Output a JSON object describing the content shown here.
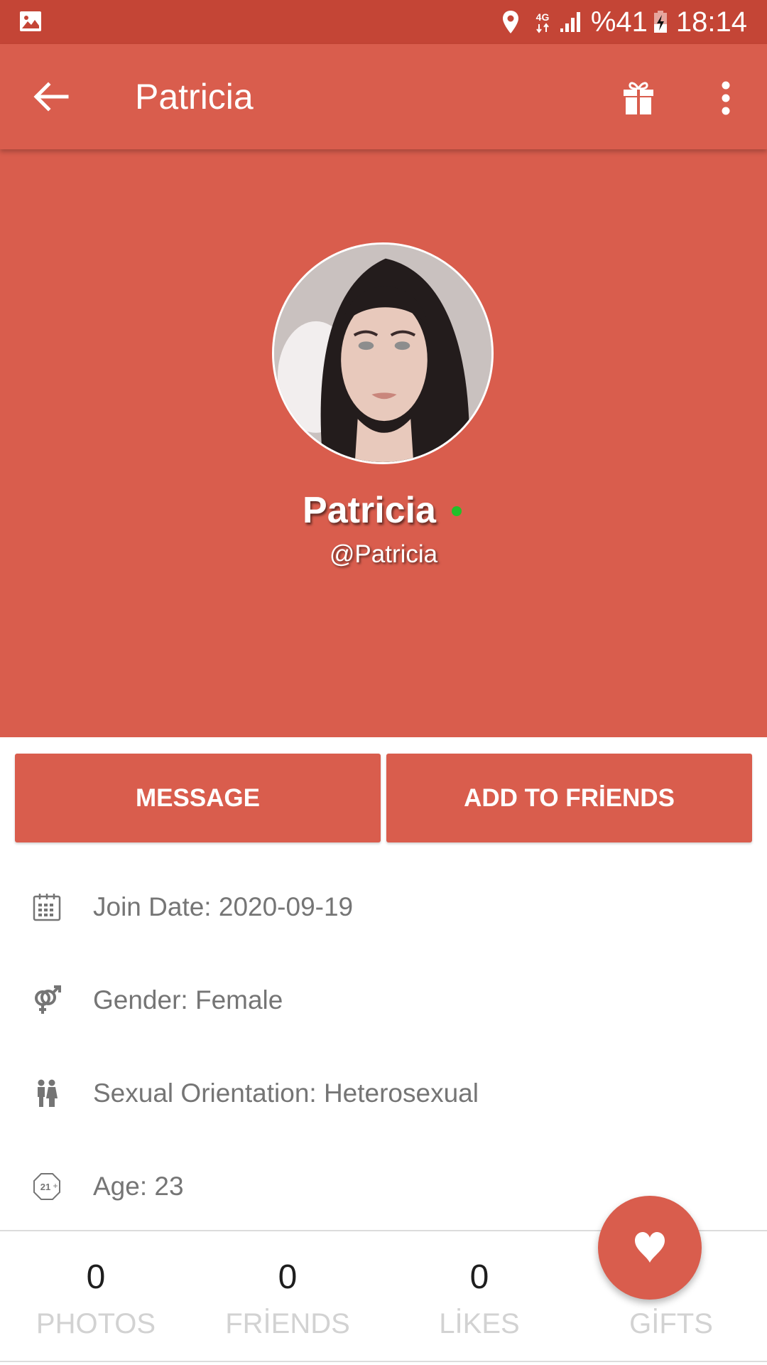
{
  "status_bar": {
    "battery_text": "%41",
    "time": "18:14",
    "network": "4G",
    "icons": [
      "gallery-icon",
      "location-icon",
      "network-4g-icon",
      "signal-icon",
      "battery-charging-icon"
    ]
  },
  "app_bar": {
    "title": "Patricia",
    "icons": {
      "back": "arrow-back-icon",
      "gift": "gift-icon",
      "more": "more-vert-icon"
    }
  },
  "profile": {
    "display_name": "Patricia",
    "username": "@Patricia",
    "online": true,
    "online_color": "#22C02A"
  },
  "actions": {
    "message_label": "MESSAGE",
    "add_friend_label": "ADD TO FRİENDS"
  },
  "info": [
    {
      "icon": "calendar-icon",
      "text": "Join Date: 2020-09-19"
    },
    {
      "icon": "gender-icon",
      "text": "Gender: Female"
    },
    {
      "icon": "couple-icon",
      "text": "Sexual Orientation: Heterosexual"
    },
    {
      "icon": "age-21-plus-icon",
      "text": "Age: 23"
    }
  ],
  "stats": [
    {
      "count": "0",
      "label": "PHOTOS"
    },
    {
      "count": "0",
      "label": "FRİENDS"
    },
    {
      "count": "0",
      "label": "LİKES"
    },
    {
      "count": "",
      "label": "GİFTS"
    }
  ],
  "fab": {
    "icon": "heart-icon"
  },
  "colors": {
    "status_bar": "#C44536",
    "primary": "#D95D4D",
    "info_text": "#757575",
    "stat_label": "#D2D2D2",
    "stat_count": "#1E1E1E"
  }
}
